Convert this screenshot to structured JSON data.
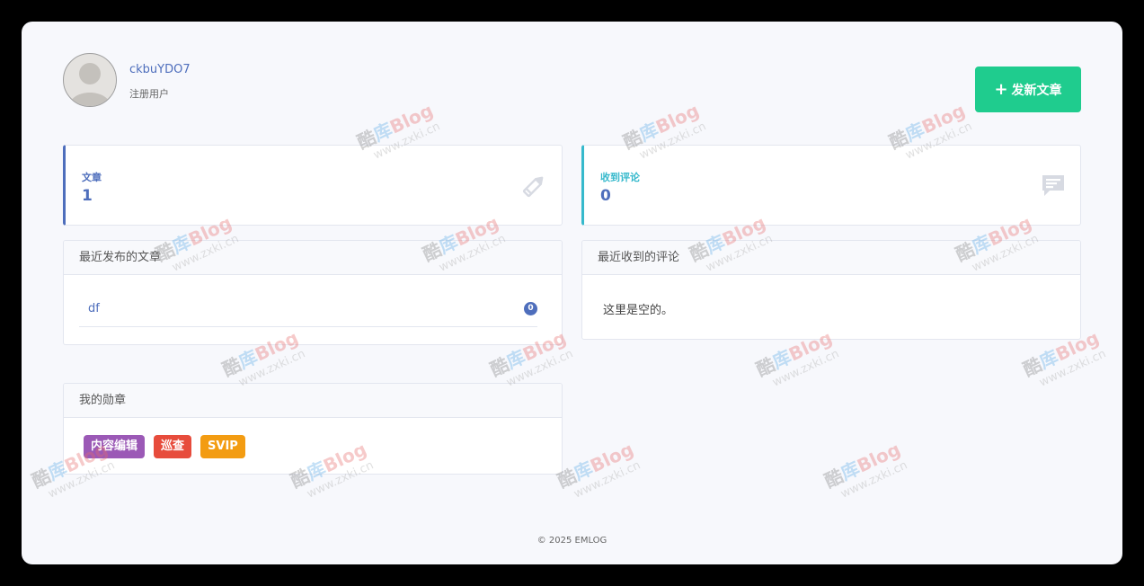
{
  "profile": {
    "username": "ckbuYDO7",
    "role": "注册用户"
  },
  "actions": {
    "new_post_label": "发新文章",
    "new_post_icon": "plus-icon"
  },
  "stats": {
    "posts": {
      "label": "文章",
      "value": "1",
      "icon": "pencil-icon",
      "accent": "#4e6ebc"
    },
    "comments": {
      "label": "收到评论",
      "value": "0",
      "icon": "comment-icon",
      "accent": "#36b9cc"
    }
  },
  "recent_posts": {
    "title": "最近发布的文章",
    "items": [
      {
        "title": "df",
        "comment_count": "0"
      }
    ]
  },
  "recent_comments": {
    "title": "最近收到的评论",
    "empty_text": "这里是空的。"
  },
  "medals": {
    "title": "我的勋章",
    "items": [
      {
        "label": "内容编辑",
        "color": "#9b59b6"
      },
      {
        "label": "巡查",
        "color": "#e74c3c"
      },
      {
        "label": "SVIP",
        "color": "#f39c12"
      }
    ]
  },
  "watermark": {
    "brand_a": "酷",
    "brand_b": "库",
    "brand_c": "Blog",
    "site": "www.zxki.cn"
  },
  "footer": {
    "text": "© 2025 EMLOG"
  }
}
